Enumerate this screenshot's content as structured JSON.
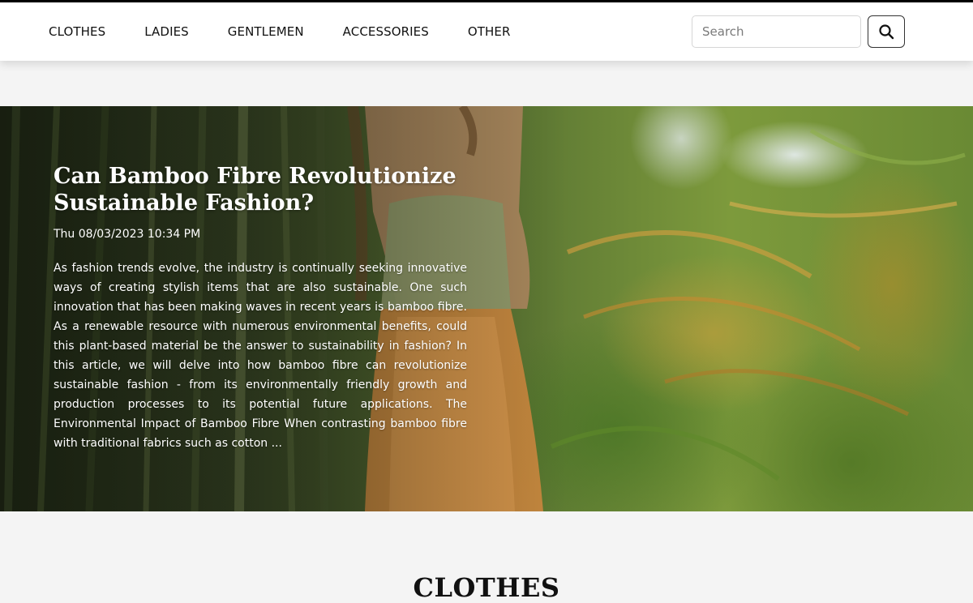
{
  "nav": {
    "items": [
      "CLOTHES",
      "LADIES",
      "GENTLEMEN",
      "ACCESSORIES",
      "OTHER"
    ],
    "search_placeholder": "Search",
    "search_icon": "search-icon"
  },
  "hero": {
    "title": "Can Bamboo Fibre Revolutionize Sustainable Fashion?",
    "date": "Thu 08/03/2023 10:34 PM",
    "excerpt": "As fashion trends evolve, the industry is continually seeking innovative ways of creating stylish items that are also sustainable. One such innovation that has been making waves in recent years is bamboo fibre. As a renewable resource with numerous environmental benefits, could this plant-based material be the answer to sustainability in fashion? In this article, we will delve into how bamboo fibre can revolutionize sustainable fashion - from its environmentally friendly growth and production processes to its potential future applications. The Environmental Impact of Bamboo Fibre When contrasting bamboo fibre with traditional fabrics such as cotton ..."
  },
  "section": {
    "title": "CLOTHES"
  },
  "colors": {
    "page_bg": "#f4f4f4",
    "navbar_bg": "#ffffff",
    "text_dark": "#111111",
    "hero_text": "#ffffff"
  }
}
